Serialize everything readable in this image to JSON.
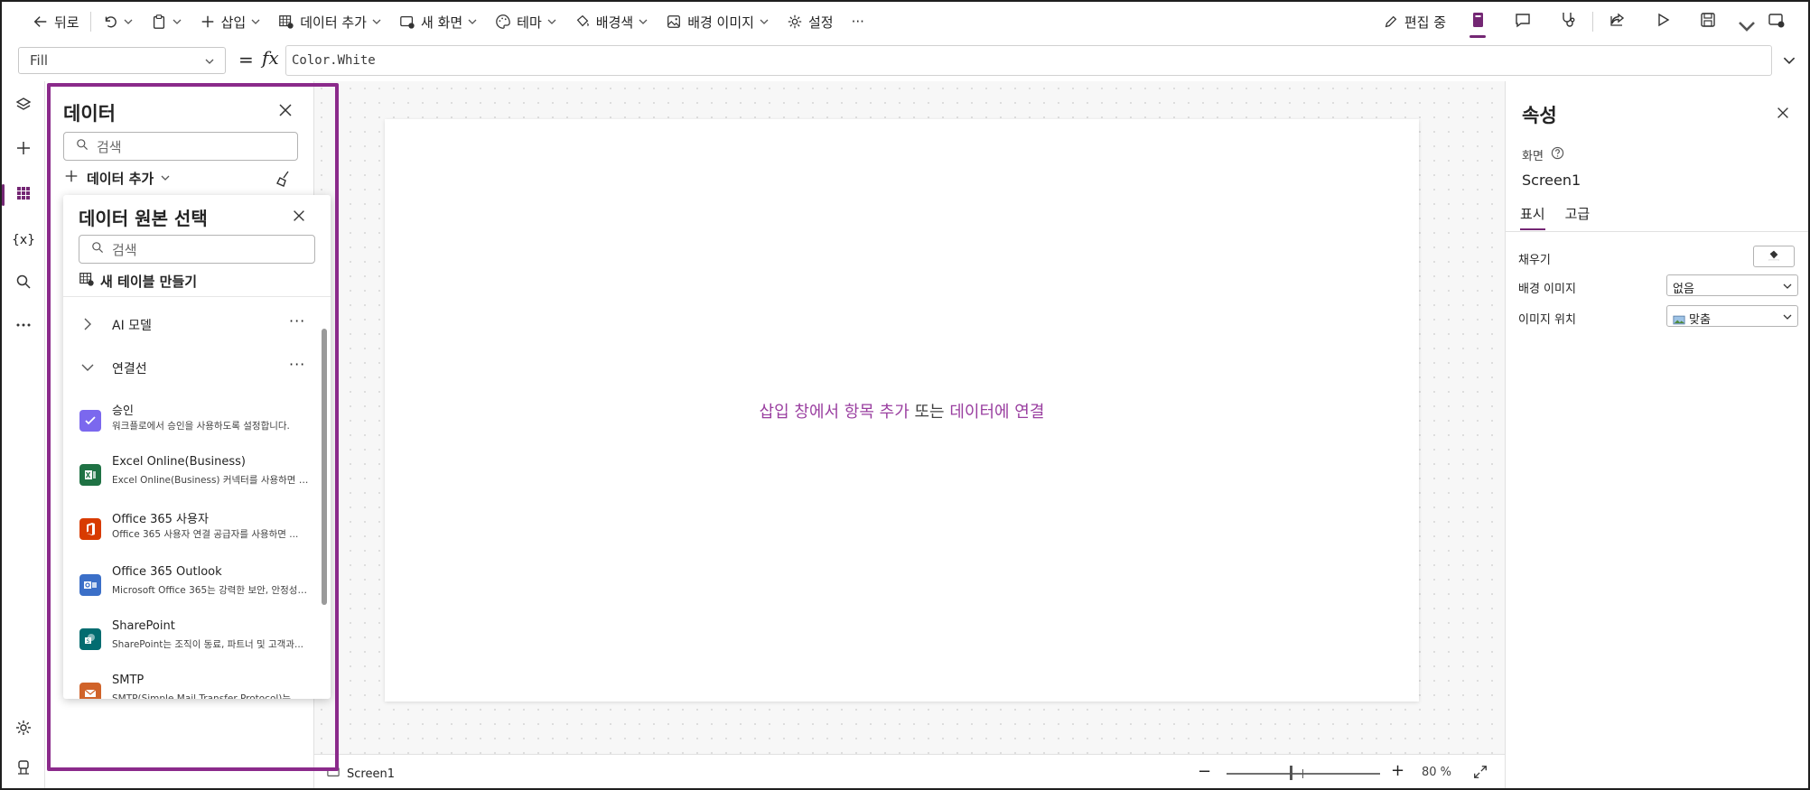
{
  "toolbar": {
    "back": "뒤로",
    "insert": "삽입",
    "add_data": "데이터 추가",
    "new_screen": "새 화면",
    "theme": "테마",
    "background_color": "배경색",
    "background_image": "배경 이미지",
    "settings": "설정",
    "more": "···",
    "editing": "편집 중"
  },
  "formula_bar": {
    "property": "Fill",
    "equals": "=",
    "fx": "fx",
    "formula": "Color.White"
  },
  "data_panel": {
    "title": "데이터",
    "search_placeholder": "검색",
    "add_data": "데이터 추가"
  },
  "flyout": {
    "title": "데이터 원본 선택",
    "search_placeholder": "검색",
    "new_table": "새 테이블 만들기",
    "groups": [
      {
        "label": "AI 모델",
        "more": "···"
      },
      {
        "label": "연결선",
        "more": "···"
      }
    ],
    "connectors": [
      {
        "name": "승인",
        "desc": "워크플로에서 승인을 사용하도록 설정합니다.",
        "color": "#7b68ee",
        "icon": "approvals-icon"
      },
      {
        "name": "Excel Online(Business)",
        "desc": "Excel Online(Business) 커넥터를 사용하면 M...",
        "color": "#1f7244",
        "icon": "excel-icon"
      },
      {
        "name": "Office 365 사용자",
        "desc": "Office 365 사용자 연결 공급자를 사용하면 ...",
        "color": "#d83b01",
        "icon": "office-icon"
      },
      {
        "name": "Office 365 Outlook",
        "desc": "Microsoft Office 365는 강력한 보안, 안정성 ...",
        "color": "#3b6fc8",
        "icon": "outlook-icon"
      },
      {
        "name": "SharePoint",
        "desc": "SharePoint는 조직이 동료, 파트너 및 고객과...",
        "color": "#036c70",
        "icon": "sharepoint-icon"
      },
      {
        "name": "SMTP",
        "desc": "SMTP(Simple Mail Transfer Protocol)는 대부...",
        "color": "#d0632a",
        "icon": "mail-icon"
      }
    ]
  },
  "canvas": {
    "hint_part1": "삽입 창에서 항목 추가",
    "hint_part2": " 또는 ",
    "hint_part3": "데이터에 연결"
  },
  "statusbar": {
    "screen": "Screen1",
    "zoom_minus": "−",
    "zoom_plus": "+",
    "zoom": "80 %"
  },
  "properties": {
    "title": "속성",
    "type": "화면",
    "name": "Screen1",
    "tabs": [
      "표시",
      "고급"
    ],
    "rows": {
      "fill_label": "채우기",
      "bg_image_label": "배경 이미지",
      "bg_image_value": "없음",
      "image_position_label": "이미지 위치",
      "image_position_value": "맞춤"
    }
  },
  "colors": {
    "accent": "#742774",
    "highlight": "#8b2a8b",
    "link": "#9a3fa0"
  }
}
